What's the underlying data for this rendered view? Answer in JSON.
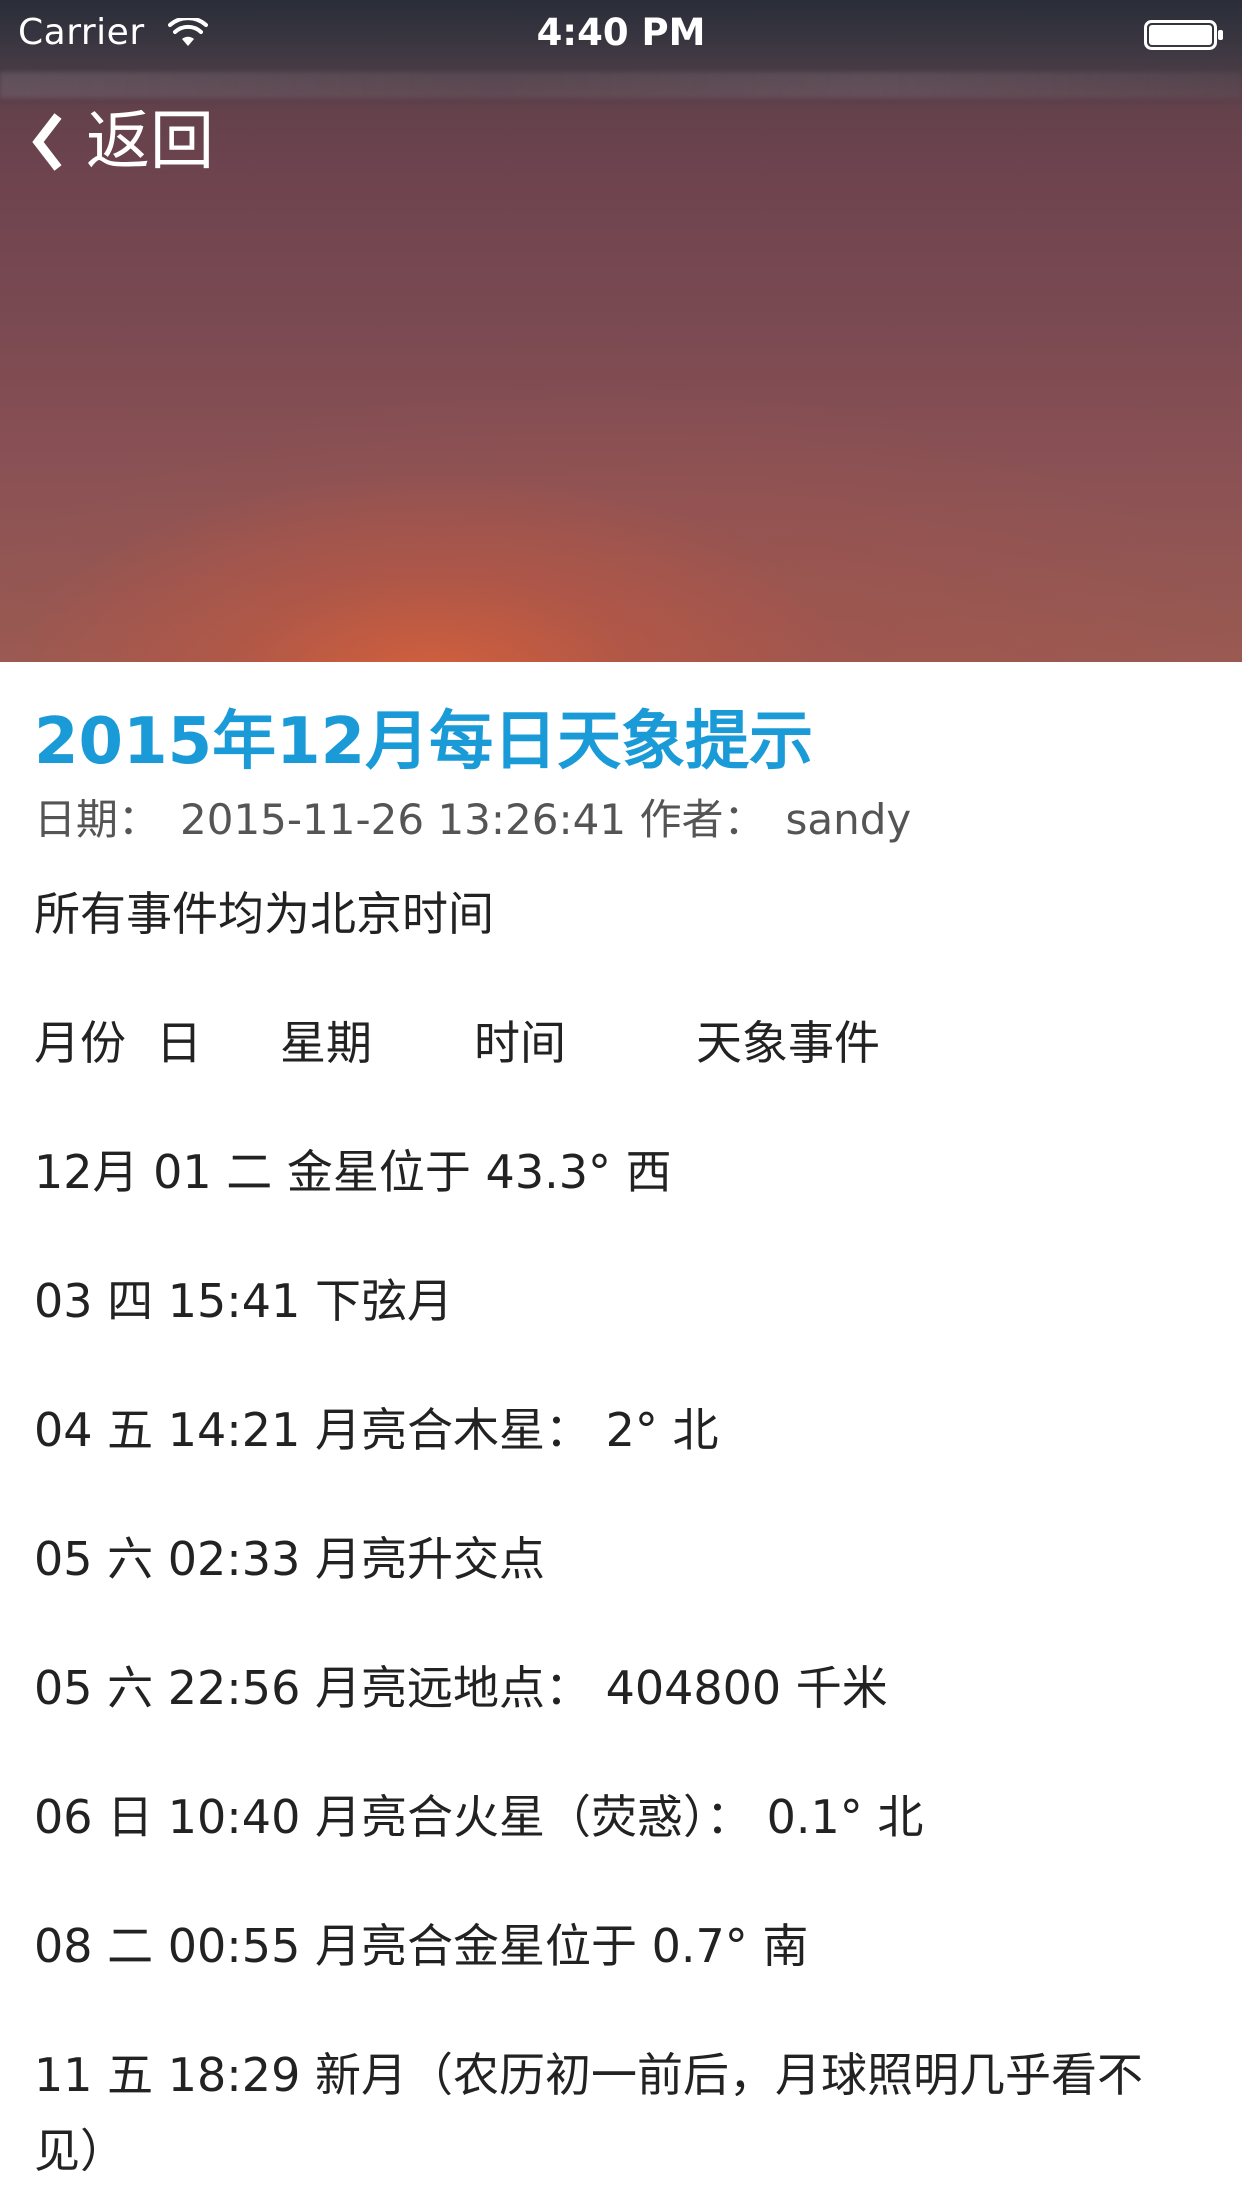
{
  "status_bar": {
    "carrier": "Carrier",
    "time": "4:40 PM"
  },
  "nav": {
    "back_label": "返回"
  },
  "article": {
    "title": "2015年12月每日天象提示",
    "meta": {
      "date_label": "日期：",
      "date_value": "2015-11-26 13:26:41",
      "author_label": "作者：",
      "author_value": "sandy"
    },
    "intro": "所有事件均为北京时间",
    "columns": [
      "月份",
      "日",
      "星期",
      "时间",
      "天象事件"
    ],
    "events": [
      "12月 01 二 金星位于 43.3° 西",
      "03 四 15:41 下弦月",
      "04 五 14:21 月亮合木星： 2° 北",
      "05 六 02:33 月亮升交点",
      "05 六 22:56 月亮远地点： 404800 千米",
      "06 日 10:40 月亮合火星（荧惑）： 0.1° 北",
      "08 二 00:55 月亮合金星位于 0.7° 南",
      "11 五 18:29 新月（农历初一前后，月球照明几乎看不见）"
    ]
  },
  "colors": {
    "title": "#1a9bd7",
    "meta": "#555555",
    "body": "#222222"
  }
}
